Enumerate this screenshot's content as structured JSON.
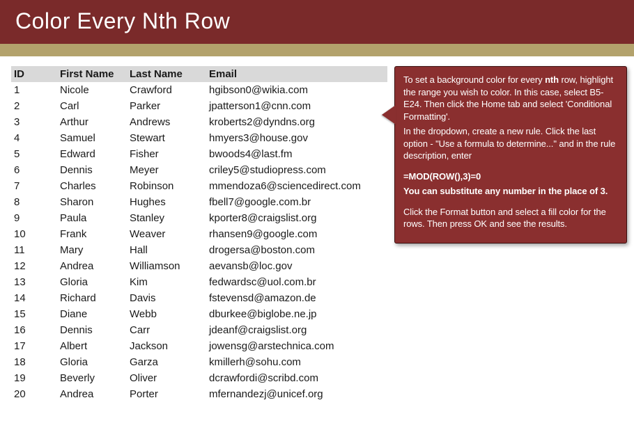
{
  "title": "Color Every Nth Row",
  "table": {
    "headers": {
      "id": "ID",
      "first": "First Name",
      "last": "Last Name",
      "email": "Email"
    },
    "rows": [
      {
        "id": "1",
        "first": "Nicole",
        "last": "Crawford",
        "email": "hgibson0@wikia.com"
      },
      {
        "id": "2",
        "first": "Carl",
        "last": "Parker",
        "email": "jpatterson1@cnn.com"
      },
      {
        "id": "3",
        "first": "Arthur",
        "last": "Andrews",
        "email": "kroberts2@dyndns.org"
      },
      {
        "id": "4",
        "first": "Samuel",
        "last": "Stewart",
        "email": "hmyers3@house.gov"
      },
      {
        "id": "5",
        "first": "Edward",
        "last": "Fisher",
        "email": "bwoods4@last.fm"
      },
      {
        "id": "6",
        "first": "Dennis",
        "last": "Meyer",
        "email": "criley5@studiopress.com"
      },
      {
        "id": "7",
        "first": "Charles",
        "last": "Robinson",
        "email": "mmendoza6@sciencedirect.com"
      },
      {
        "id": "8",
        "first": "Sharon",
        "last": "Hughes",
        "email": "fbell7@google.com.br"
      },
      {
        "id": "9",
        "first": "Paula",
        "last": "Stanley",
        "email": "kporter8@craigslist.org"
      },
      {
        "id": "10",
        "first": "Frank",
        "last": "Weaver",
        "email": "rhansen9@google.com"
      },
      {
        "id": "11",
        "first": "Mary",
        "last": "Hall",
        "email": "drogersa@boston.com"
      },
      {
        "id": "12",
        "first": "Andrea",
        "last": "Williamson",
        "email": "aevansb@loc.gov"
      },
      {
        "id": "13",
        "first": "Gloria",
        "last": "Kim",
        "email": "fedwardsc@uol.com.br"
      },
      {
        "id": "14",
        "first": "Richard",
        "last": "Davis",
        "email": "fstevensd@amazon.de"
      },
      {
        "id": "15",
        "first": "Diane",
        "last": "Webb",
        "email": "dburkee@biglobe.ne.jp"
      },
      {
        "id": "16",
        "first": "Dennis",
        "last": "Carr",
        "email": "jdeanf@craigslist.org"
      },
      {
        "id": "17",
        "first": "Albert",
        "last": "Jackson",
        "email": "jowensg@arstechnica.com"
      },
      {
        "id": "18",
        "first": "Gloria",
        "last": "Garza",
        "email": "kmillerh@sohu.com"
      },
      {
        "id": "19",
        "first": "Beverly",
        "last": "Oliver",
        "email": "dcrawfordi@scribd.com"
      },
      {
        "id": "20",
        "first": "Andrea",
        "last": "Porter",
        "email": "mfernandezj@unicef.org"
      }
    ]
  },
  "callout": {
    "p1a": "To set a background color for every ",
    "p1b": "nth",
    "p1c": " row, highlight the range you wish to color. In this case, select B5-E24. Then click the Home tab and select 'Conditional Formatting'.",
    "p2": "In the dropdown, create a new rule. Click the last option - \"Use a formula to determine...\" and in the rule description, enter",
    "formula": "=MOD(ROW(),3)=0",
    "sub": "You can substitute any number in the place of 3.",
    "p3": "Click the Format button and select a fill color for the rows. Then press OK and see the results."
  }
}
